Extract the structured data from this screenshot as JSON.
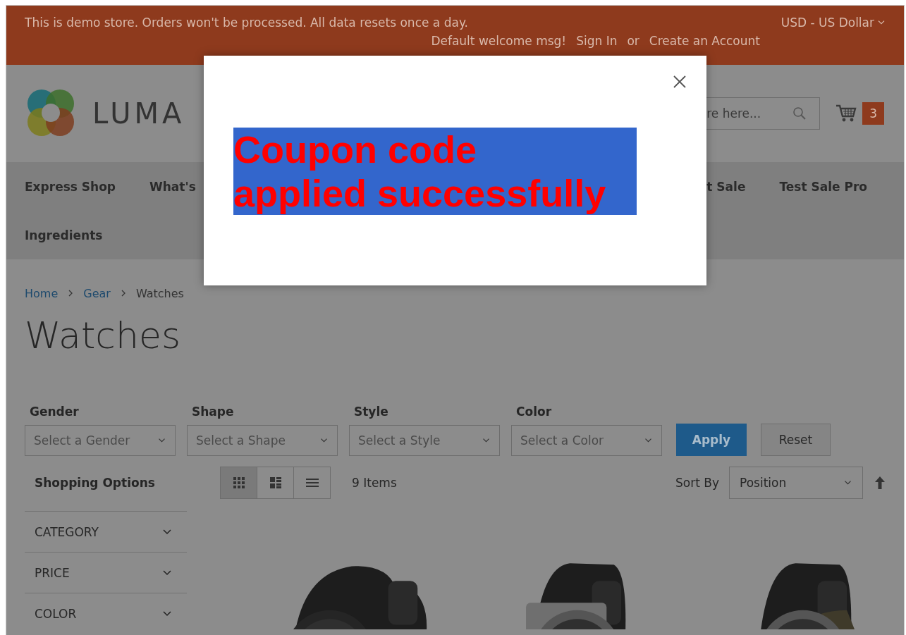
{
  "top_bar": {
    "notice": "This is demo store. Orders won't be processed. All data resets once a day.",
    "currency": "USD - US Dollar",
    "welcome": "Default welcome msg!",
    "sign_in": "Sign In",
    "or": "or",
    "create_account": "Create an Account"
  },
  "header": {
    "logo": "LUMA",
    "search": {
      "placeholder": "re here..."
    },
    "cart_count": "3"
  },
  "nav_rows": [
    {
      "left_items": [
        {
          "label": "Express Shop"
        },
        {
          "label": "What's"
        }
      ],
      "right_items": [
        {
          "label": "t Sale"
        },
        {
          "label": "Test Sale Pro"
        }
      ]
    },
    {
      "left_items": [
        {
          "label": "Ingredients"
        }
      ],
      "right_items": []
    }
  ],
  "breadcrumbs": [
    {
      "label": "Home",
      "kind": "link"
    },
    {
      "label": "Gear",
      "kind": "link"
    },
    {
      "label": "Watches",
      "kind": "current"
    }
  ],
  "title": "Watches",
  "filters": [
    {
      "label": "Gender",
      "placeholder": "Select a Gender"
    },
    {
      "label": "Shape",
      "placeholder": "Select a Shape"
    },
    {
      "label": "Style",
      "placeholder": "Select a Style"
    },
    {
      "label": "Color",
      "placeholder": "Select a Color"
    }
  ],
  "filter_buttons": {
    "apply": "Apply",
    "reset": "Reset"
  },
  "sidebar": {
    "title": "Shopping Options",
    "sections": [
      {
        "label": "CATEGORY",
        "expanded": false
      },
      {
        "label": "PRICE",
        "expanded": false
      },
      {
        "label": "COLOR",
        "expanded": false
      }
    ]
  },
  "toolbar": {
    "view_modes": [
      {
        "kind": "grid",
        "selected": true
      },
      {
        "kind": "tiles",
        "selected": false
      },
      {
        "kind": "list",
        "selected": false
      }
    ],
    "count": "9 Items",
    "sort_label": "Sort By",
    "sort_value": "Position"
  },
  "modal": {
    "message_lines": [
      "Coupon code",
      "applied successfully"
    ]
  }
}
